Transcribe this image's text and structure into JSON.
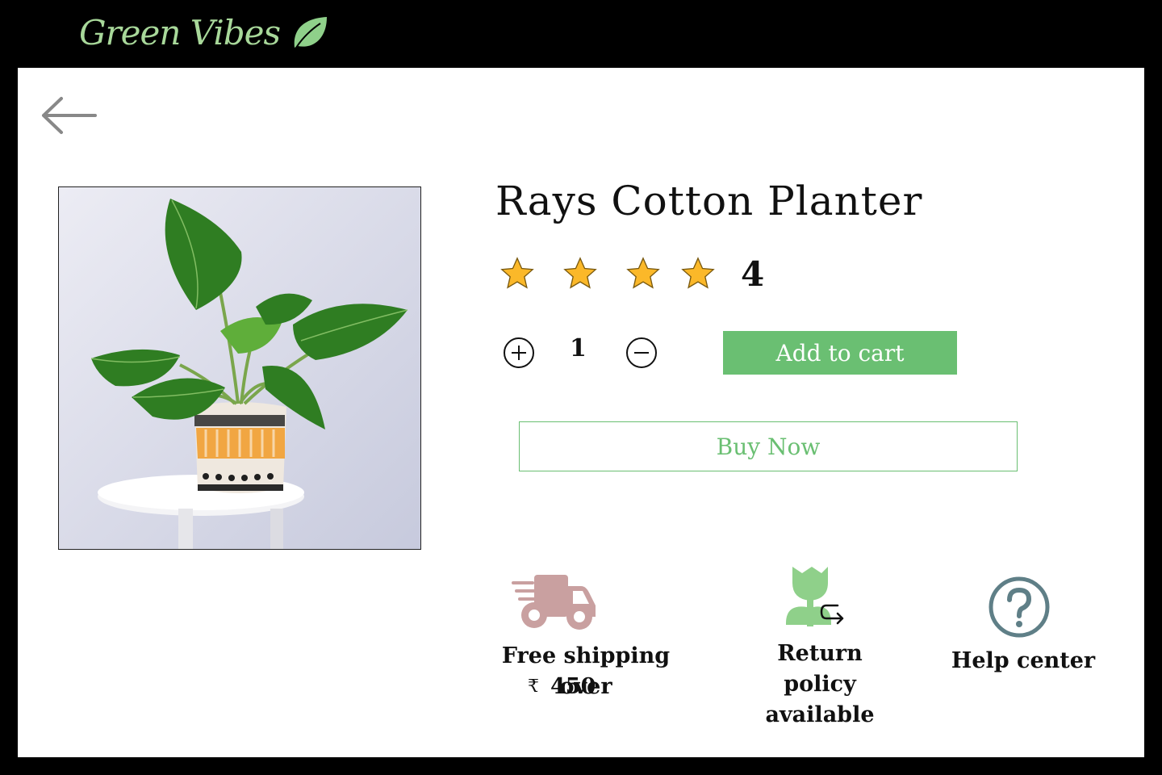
{
  "header": {
    "brand_name": "Green Vibes",
    "brand_icon": "leaf-icon",
    "brand_color": "#a8d89a",
    "background_color": "#000000"
  },
  "navigation": {
    "back_icon": "back-arrow-icon"
  },
  "product": {
    "title": "Rays Cotton Planter",
    "image": "plant-in-woven-basket-planter",
    "rating_stars": 4,
    "rating_label": "4",
    "star_color": "#fbb829"
  },
  "quantity": {
    "plus_icon": "plus-circle-icon",
    "minus_icon": "minus-circle-icon",
    "value": "1"
  },
  "actions": {
    "add_to_cart_label": "Add to cart",
    "buy_now_label": "Buy Now",
    "accent_color": "#6abf72"
  },
  "features": {
    "shipping": {
      "icon": "delivery-truck-icon",
      "label": "Free shipping over",
      "currency": "₹",
      "amount": "450",
      "icon_color": "#c9a0a0"
    },
    "returns": {
      "icon": "return-plant-icon",
      "label_line1": "Return policy",
      "label_line2": "available",
      "icon_color": "#8fd08a"
    },
    "help": {
      "icon": "help-question-icon",
      "label": "Help center",
      "icon_color": "#5f7f87"
    }
  }
}
